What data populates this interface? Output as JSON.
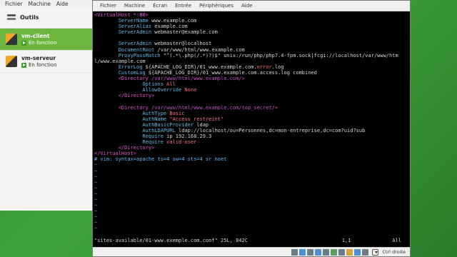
{
  "manager": {
    "menu": [
      "Fichier",
      "Machine",
      "Aide"
    ],
    "tools_label": "Outils",
    "vms": [
      {
        "name": "vm-client",
        "status": "En fonction",
        "selected": true
      },
      {
        "name": "vm-serveur",
        "status": "En fonction",
        "selected": false
      }
    ]
  },
  "vm_window": {
    "menu": [
      "Fichier",
      "Machine",
      "Écran",
      "Entrée",
      "Périphériques",
      "Aide"
    ],
    "status_file": "\"sites-available/01-www.exemple.com.conf\" 25L, 842C",
    "status_pos": "1,1",
    "status_scroll": "All",
    "host_key": "Ctrl droite"
  },
  "editor_lines": [
    [
      {
        "t": "<VirtualHost ",
        "c": "c-tag"
      },
      {
        "t": "*:80",
        "c": "c-tagnum"
      },
      {
        "t": ">",
        "c": "c-tag"
      }
    ],
    [
      {
        "t": "        ServerName",
        "c": "c-kw"
      },
      {
        "t": " www.example.com",
        "c": "c-val"
      }
    ],
    [
      {
        "t": "        ServerAlias",
        "c": "c-kw"
      },
      {
        "t": " example.com",
        "c": "c-val"
      }
    ],
    [
      {
        "t": "        ServerAdmin",
        "c": "c-kw"
      },
      {
        "t": " webmaster@example.com",
        "c": "c-val"
      }
    ],
    [
      {
        "t": "",
        "c": "c-val"
      }
    ],
    [
      {
        "t": "        ServerAdmin",
        "c": "c-kw"
      },
      {
        "t": " webmaster@localhost",
        "c": "c-val"
      }
    ],
    [
      {
        "t": "        DocumentRoot",
        "c": "c-kw"
      },
      {
        "t": " /var/www/html/www.example.com",
        "c": "c-val"
      }
    ],
    [
      {
        "t": "        ProxyPassMatch",
        "c": "c-kw"
      },
      {
        "t": " \"^(.*\\.php(/.*)?)$\" unix:/run/php/php7.4-fpm.sock|fcgi://localhost/var/www/htm",
        "c": "c-val"
      }
    ],
    [
      {
        "t": "l/www.example.com",
        "c": "c-val"
      }
    ],
    [
      {
        "t": "        ErrorLog",
        "c": "c-kw"
      },
      {
        "t": " ${APACHE_LOG_DIR}/01_www.example.com.",
        "c": "c-val"
      },
      {
        "t": "error",
        "c": "c-err"
      },
      {
        "t": ".log",
        "c": "c-val"
      }
    ],
    [
      {
        "t": "        CustomLog",
        "c": "c-kw"
      },
      {
        "t": " ${APACHE_LOG_DIR}/01_www.example.com.access.log combined",
        "c": "c-val"
      }
    ],
    [
      {
        "t": "        <Directory ",
        "c": "c-tag"
      },
      {
        "t": "/var/www/html/www.example.com/",
        "c": "c-path"
      },
      {
        "t": ">",
        "c": "c-tag"
      }
    ],
    [
      {
        "t": "                Options",
        "c": "c-kw"
      },
      {
        "t": " All",
        "c": "c-str"
      }
    ],
    [
      {
        "t": "                AllowOverride",
        "c": "c-kw"
      },
      {
        "t": " None",
        "c": "c-str"
      }
    ],
    [
      {
        "t": "        </Directory>",
        "c": "c-tag"
      }
    ],
    [
      {
        "t": "",
        "c": "c-val"
      }
    ],
    [
      {
        "t": "        <Directory ",
        "c": "c-tag"
      },
      {
        "t": "/var/www/html/www.example.com/top_secret/",
        "c": "c-path"
      },
      {
        "t": ">",
        "c": "c-tag"
      }
    ],
    [
      {
        "t": "                AuthType",
        "c": "c-kw"
      },
      {
        "t": " Basic",
        "c": "c-str"
      }
    ],
    [
      {
        "t": "                AuthName",
        "c": "c-kw"
      },
      {
        "t": " \"Access restreint\"",
        "c": "c-str"
      }
    ],
    [
      {
        "t": "                AuthBasicProvider",
        "c": "c-kw"
      },
      {
        "t": " ldap",
        "c": "c-val"
      }
    ],
    [
      {
        "t": "                AuthLDAPURL",
        "c": "c-kw"
      },
      {
        "t": " ldap://localhost/ou=Personnes,dc=mon-entreprise,dc=com?uid?sub",
        "c": "c-val"
      }
    ],
    [
      {
        "t": "                Require",
        "c": "c-kw"
      },
      {
        "t": " ip 192.168.29.3",
        "c": "c-val"
      }
    ],
    [
      {
        "t": "                Require",
        "c": "c-kw"
      },
      {
        "t": " valid-user",
        "c": "c-str"
      }
    ],
    [
      {
        "t": "        </Directory>",
        "c": "c-tag"
      }
    ],
    [
      {
        "t": "</VirtualHost>",
        "c": "c-tag"
      }
    ],
    [
      {
        "t": "# vim: syntax=apache ts=4 sw=4 sts=4 sr noet",
        "c": "c-cmt"
      }
    ],
    [
      {
        "t": "~",
        "c": "c-tilde"
      }
    ],
    [
      {
        "t": "~",
        "c": "c-tilde"
      }
    ],
    [
      {
        "t": "~",
        "c": "c-tilde"
      }
    ],
    [
      {
        "t": "~",
        "c": "c-tilde"
      }
    ],
    [
      {
        "t": "~",
        "c": "c-tilde"
      }
    ],
    [
      {
        "t": "~",
        "c": "c-tilde"
      }
    ],
    [
      {
        "t": "~",
        "c": "c-tilde"
      }
    ],
    [
      {
        "t": "~",
        "c": "c-tilde"
      }
    ],
    [
      {
        "t": "~",
        "c": "c-tilde"
      }
    ],
    [
      {
        "t": "~",
        "c": "c-tilde"
      }
    ],
    [
      {
        "t": "~",
        "c": "c-tilde"
      }
    ],
    [
      {
        "t": "~",
        "c": "c-tilde"
      }
    ]
  ]
}
